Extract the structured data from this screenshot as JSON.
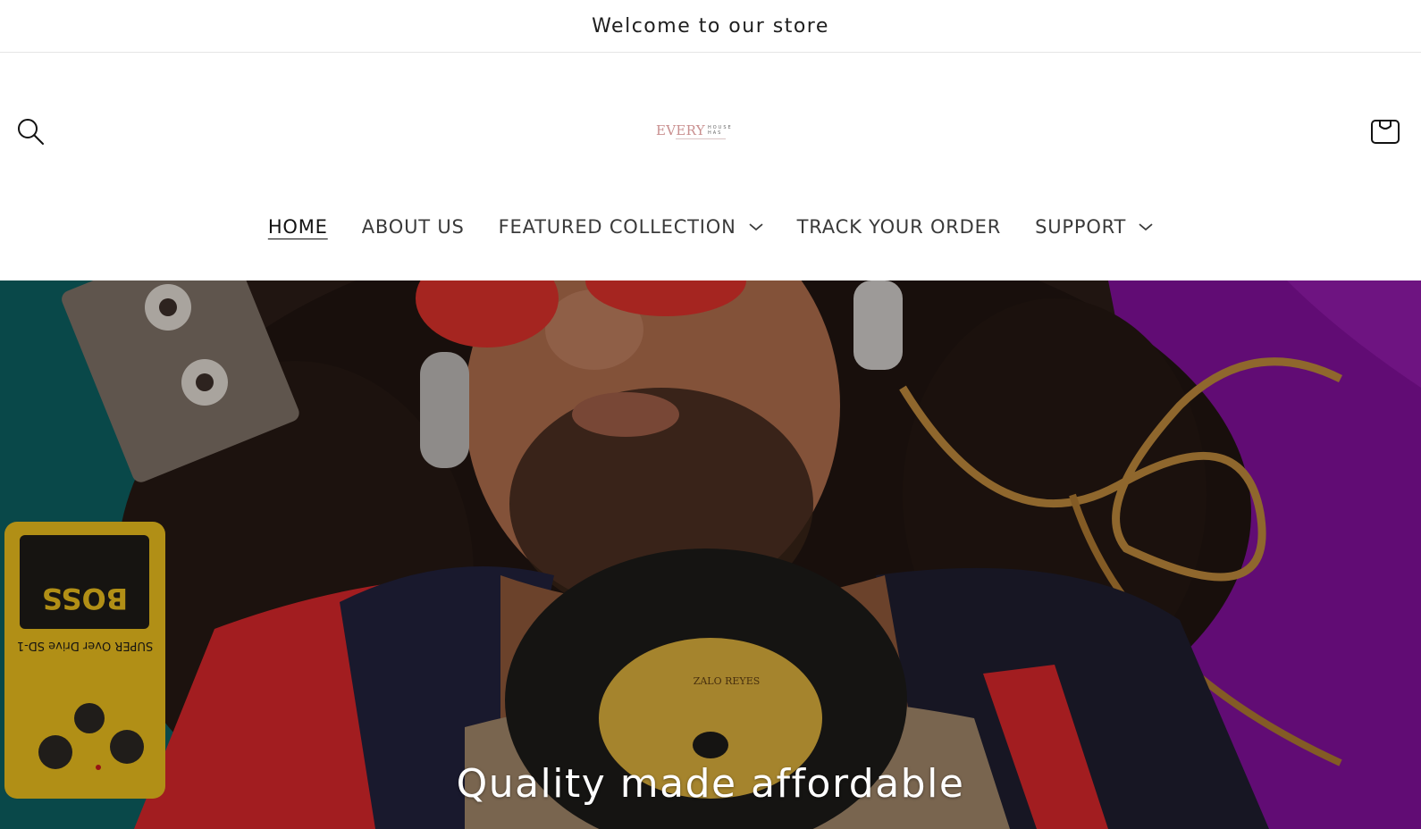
{
  "announcement": {
    "text": "Welcome to our store"
  },
  "header": {
    "search_icon": "search-icon",
    "cart_icon": "cart-icon",
    "logo": {
      "word": "EVERY",
      "line1": "HOUSE",
      "line2": "HAS"
    }
  },
  "nav": {
    "items": [
      {
        "label": "HOME",
        "active": true,
        "dropdown": false
      },
      {
        "label": "ABOUT US",
        "active": false,
        "dropdown": false
      },
      {
        "label": "FEATURED COLLECTION",
        "active": false,
        "dropdown": true
      },
      {
        "label": "TRACK YOUR ORDER",
        "active": false,
        "dropdown": false
      },
      {
        "label": "SUPPORT",
        "active": false,
        "dropdown": true
      }
    ]
  },
  "hero": {
    "heading": "Quality made affordable",
    "pedal_brand": "BOSS",
    "pedal_model": "SUPER Over Drive SD-1",
    "record_label": "ZALO REYES"
  },
  "colors": {
    "accent_logo": "#c98f8f",
    "text": "#121212",
    "hero_overlay": "rgba(0,0,0,0.22)"
  }
}
